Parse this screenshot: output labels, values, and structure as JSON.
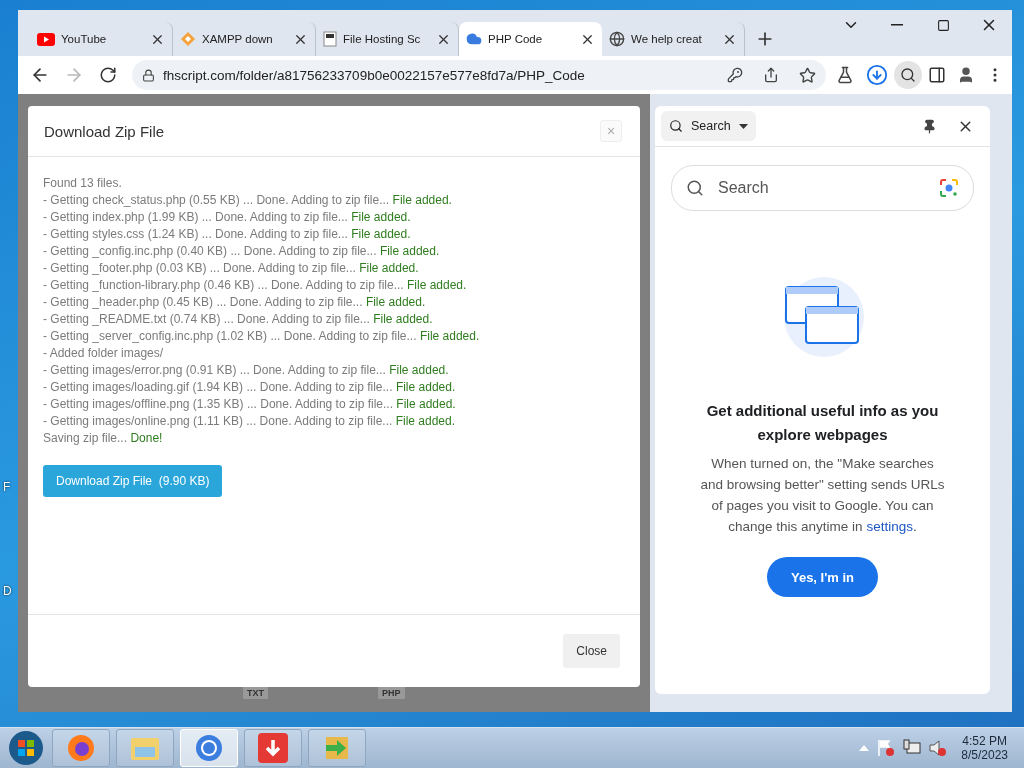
{
  "tabs": [
    {
      "kind": "youtube",
      "title": "YouTube",
      "selected": false
    },
    {
      "kind": "diamond",
      "title": "XAMPP down",
      "selected": false
    },
    {
      "kind": "file",
      "title": "File Hosting Sc",
      "selected": false
    },
    {
      "kind": "cloud",
      "title": "PHP Code",
      "selected": true
    },
    {
      "kind": "globe",
      "title": "We help creat",
      "selected": false
    }
  ],
  "nav": [
    {
      "kind": "back",
      "disabled": false
    },
    {
      "kind": "forward",
      "disabled": true
    },
    {
      "kind": "reload",
      "disabled": false
    }
  ],
  "address": "fhscript.com/folder/a81756233709b0e0022157e577e8fd7a/PHP_Code",
  "desktop_labels": [
    "F",
    "D"
  ],
  "behind_modal": [
    "TXT",
    "PHP"
  ],
  "modal": {
    "title": "Download Zip File",
    "close_glyph": "×",
    "log": [
      {
        "text": "Found 13 files."
      },
      {
        "text": "- Getting check_status.php (0.55 KB) ... Done. Adding to zip file...",
        "result": "File added."
      },
      {
        "text": "- Getting index.php (1.99 KB) ... Done. Adding to zip file...",
        "result": "File added."
      },
      {
        "text": "- Getting styles.css (1.24 KB) ... Done. Adding to zip file...",
        "result": "File added."
      },
      {
        "text": "- Getting _config.inc.php (0.40 KB) ... Done. Adding to zip file...",
        "result": "File added."
      },
      {
        "text": "- Getting _footer.php (0.03 KB) ... Done. Adding to zip file...",
        "result": "File added."
      },
      {
        "text": "- Getting _function-library.php (0.46 KB) ... Done. Adding to zip file...",
        "result": "File added."
      },
      {
        "text": "- Getting _header.php (0.45 KB) ... Done. Adding to zip file...",
        "result": "File added."
      },
      {
        "text": "- Getting _README.txt (0.74 KB) ... Done. Adding to zip file...",
        "result": "File added."
      },
      {
        "text": "- Getting _server_config.inc.php (1.02 KB) ... Done. Adding to zip file...",
        "result": "File added."
      },
      {
        "text": "- Added folder images/"
      },
      {
        "text": "- Getting images/error.png (0.91 KB) ... Done. Adding to zip file...",
        "result": "File added."
      },
      {
        "text": "- Getting images/loading.gif (1.94 KB) ... Done. Adding to zip file...",
        "result": "File added."
      },
      {
        "text": "- Getting images/offline.png (1.35 KB) ... Done. Adding to zip file...",
        "result": "File added."
      },
      {
        "text": "- Getting images/online.png (1.11 KB) ... Done. Adding to zip file...",
        "result": "File added."
      },
      {
        "text": "Saving zip file...",
        "result": "Done!"
      }
    ],
    "download_button": "Download Zip File  (9.90 KB)",
    "close_button": "Close"
  },
  "side_panel": {
    "mode": "Search",
    "search_placeholder": "Search",
    "heading": "Get additional useful info as you explore webpages",
    "body": "When turned on, the \"Make searches and browsing better\" setting sends URLs of pages you visit to Google. You can change this anytime in",
    "link": "settings",
    "link_after": ".",
    "button": "Yes, I'm in"
  },
  "taskbar": {
    "apps": [
      {
        "kind": "firefox",
        "selected": false
      },
      {
        "kind": "explorer",
        "selected": false
      },
      {
        "kind": "chrome",
        "selected": true
      },
      {
        "kind": "downloader",
        "selected": false
      },
      {
        "kind": "arrow",
        "selected": false
      }
    ],
    "time": "4:52 PM",
    "date": "8/5/2023"
  }
}
